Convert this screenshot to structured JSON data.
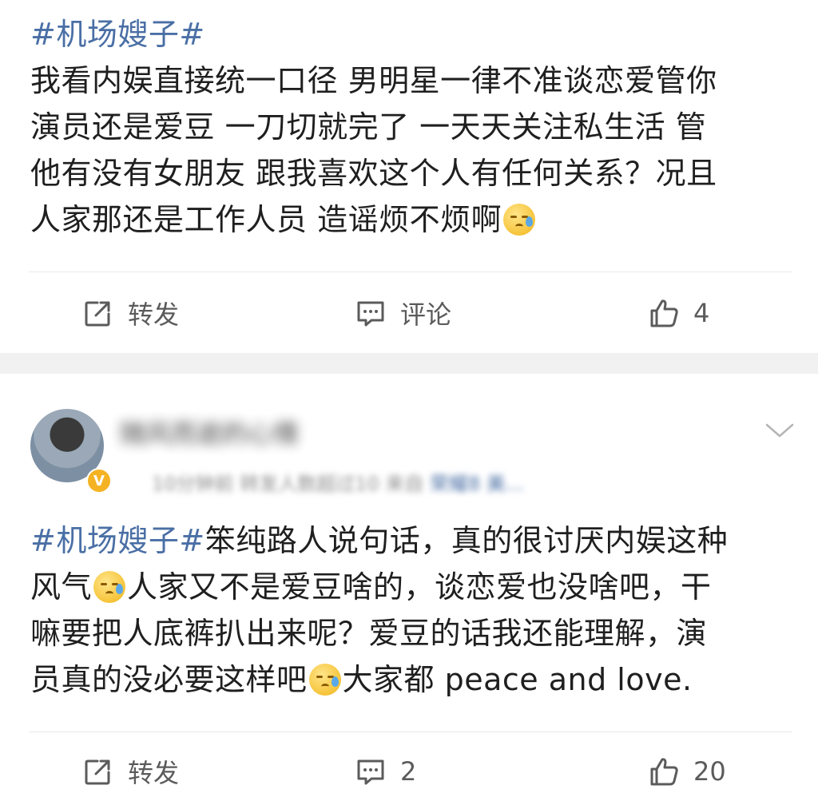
{
  "post1": {
    "hashtag": "#机场嫂子#",
    "lines": [
      "我看内娱直接统一口径 男明星一律不准谈恋爱管你",
      "演员还是爱豆 一刀切就完了 一天天关注私生活 管",
      "他有没有女朋友 跟我喜欢这个人有任何关系？况且",
      "人家那还是工作人员 造谣烦不烦啊"
    ],
    "actions": {
      "repost_label": "转发",
      "comment_label": "评论",
      "like_count": "4"
    }
  },
  "post2": {
    "author": {
      "name": "随风而逝的心情",
      "time": "10分钟前",
      "views": "转发人数超过10",
      "source_prefix": "来自",
      "source": "荣耀8 美..."
    },
    "hashtag": "#机场嫂子#",
    "lines": [
      "笨纯路人说句话，真的很讨厌内娱这种",
      "风气",
      "人家又不是爱豆啥的，谈恋爱也没啥吧，干",
      "嘛要把人底裤扒出来呢？爱豆的话我还能理解，演",
      "员真的没必要这样吧",
      "大家都 peace and love."
    ],
    "actions": {
      "repost_label": "转发",
      "comment_count": "2",
      "like_count": "20"
    }
  },
  "colors": {
    "hashtag": "#4a6fa5",
    "separator": "#f1f1f1",
    "icon": "#5b5b5b"
  }
}
